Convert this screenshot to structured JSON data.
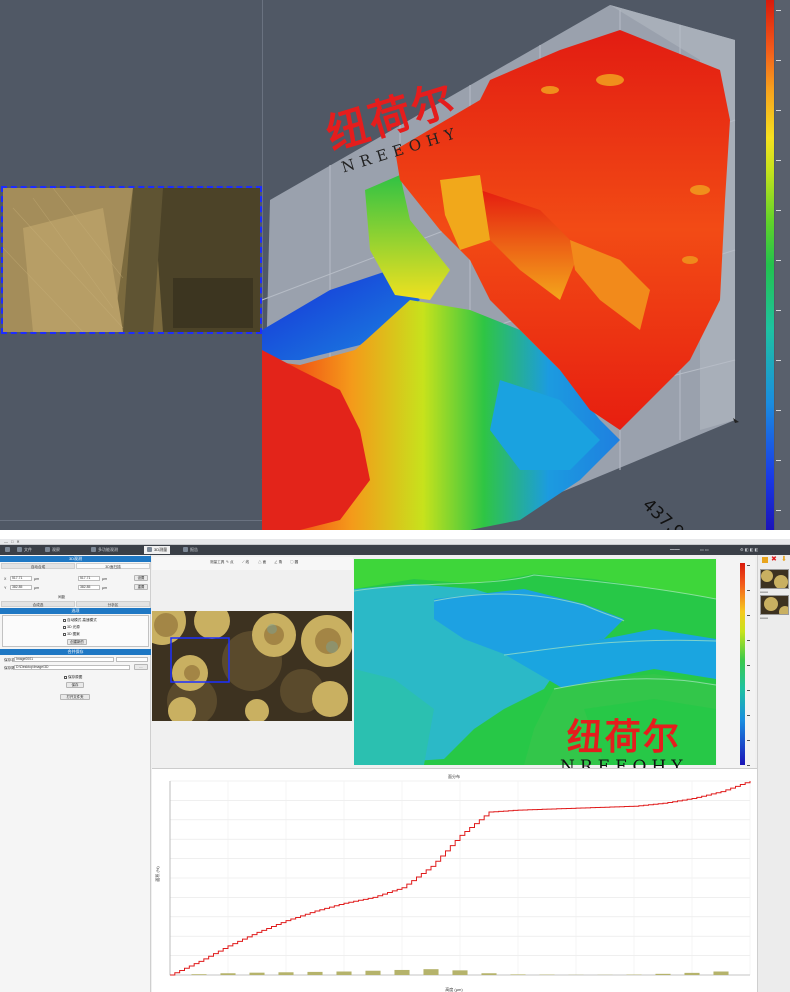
{
  "top_view": {
    "watermark_cn": "纽荷尔",
    "watermark_en": "NREEOHY",
    "axis_label": "437.9"
  },
  "window": {
    "tabs": [
      {
        "label": "",
        "icon": "home-icon"
      },
      {
        "label": "文件",
        "icon": "file-icon"
      },
      {
        "label": "观察",
        "icon": "observe-icon"
      },
      {
        "label": "多功能观测",
        "icon": "multi-observe-icon"
      },
      {
        "label": "3D测量",
        "icon": "measure-3d-icon"
      },
      {
        "label": "报告",
        "icon": "report-icon"
      }
    ],
    "active_tab": 4
  },
  "left_panel": {
    "section1_title": "3D观测",
    "subtabs": [
      "自动合成",
      "3D面扫描"
    ],
    "x_label": "X",
    "y_label": "Y",
    "x_value": "517.71",
    "y_value": "382.85",
    "x_unit": "μm",
    "y_unit": "μm",
    "btn_set": "设置",
    "btn_reset": "重置",
    "step_label": "间距",
    "subtabs2": [
      "合成选",
      "分析区"
    ],
    "section2_title": "选项",
    "checks": [
      "自动模式 高速模式",
      "3D 光源",
      "3D 图案"
    ],
    "btn_sub": "创建新的",
    "section3_title": "合并保存",
    "save_label": "保存名",
    "save_path_label": "保存路径",
    "save_name": "Image0001",
    "save_path": "D:\\Desktop\\Image\\3D",
    "check_save": "保存原图",
    "btn_save": "保存",
    "btn_open": "打开文件夹"
  },
  "toolbar": {
    "label": "测量工具",
    "tools": [
      "点",
      "线",
      "面",
      "角",
      "圆"
    ]
  },
  "bottom_view": {
    "watermark_cn": "纽荷尔",
    "watermark_en": "NREEOHY"
  },
  "chart_data": {
    "type": "line",
    "title": "面分布",
    "xlabel": "高度 (μm)",
    "ylabel": "面积 (%)",
    "ylim": [
      0,
      100
    ],
    "series": [
      {
        "x": [
          0,
          5,
          10,
          15,
          20,
          25,
          30,
          35,
          40,
          45,
          50,
          55,
          60,
          65,
          70,
          75,
          80,
          85,
          90,
          95,
          100
        ],
        "values": [
          0,
          7,
          15,
          22,
          28,
          33,
          37,
          40,
          45,
          56,
          72,
          84,
          85,
          85.5,
          86,
          86.5,
          87,
          88.5,
          91,
          94.5,
          100
        ]
      },
      {
        "x": [
          5,
          10,
          15,
          20,
          25,
          30,
          35,
          40,
          45,
          50,
          55,
          60,
          65,
          70,
          75,
          80,
          85,
          90,
          95
        ],
        "values": [
          0.4,
          0.9,
          1.2,
          1.4,
          1.6,
          1.8,
          2.2,
          2.6,
          3.0,
          2.4,
          0.9,
          0.3,
          0.2,
          0.1,
          0.1,
          0.2,
          0.6,
          1.1,
          1.8
        ]
      }
    ]
  },
  "colors": {
    "accent": "#1f78c4",
    "curve": "#e01b1b",
    "bars": "#b5b36b"
  }
}
